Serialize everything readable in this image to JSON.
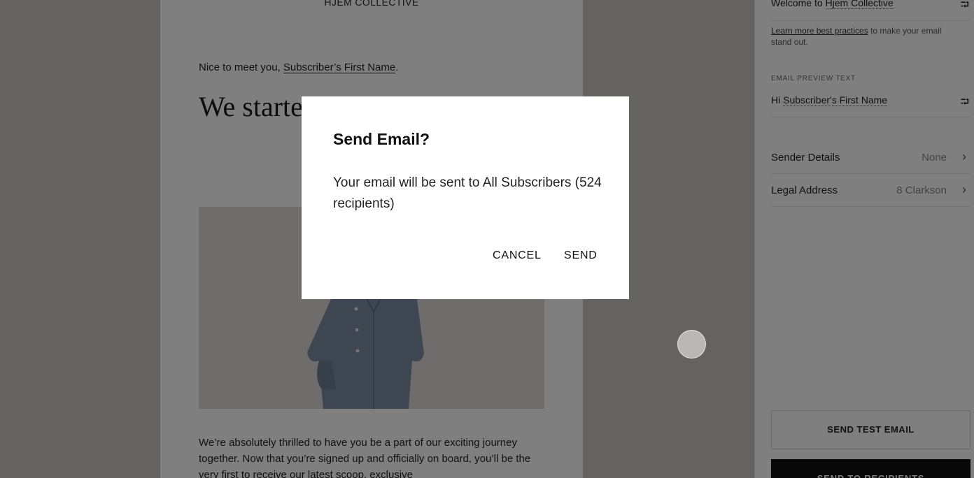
{
  "email": {
    "brand": "HJEM COLLECTIVE",
    "greeting_prefix": "Nice to meet you, ",
    "greeting_merge": "Subscriber’s First Name",
    "greeting_suffix": ".",
    "headline": "We started with a mi products t",
    "body": "We’re absolutely thrilled to have you be a part of our exciting journey together. Now that you’re signed up and officially on board, you’ll be the very first to receive our latest scoop, exclusive"
  },
  "panel": {
    "subject_prefix": "Welcome to ",
    "subject_merge": "Hjem Collective",
    "hint_link": "Learn more best practices",
    "hint_text": " to make your email stand out.",
    "preview_label": "EMAIL PREVIEW TEXT",
    "preview_prefix": "Hi ",
    "preview_merge": "Subscriber's First Name",
    "sender_label": "Sender Details",
    "sender_value": "None",
    "legal_label": "Legal Address",
    "legal_value": "8 Clarkson",
    "send_test_label": "SEND TEST EMAIL",
    "send_recipients_label": "SEND TO RECIPIENTS"
  },
  "dialog": {
    "title": "Send Email?",
    "message": "Your email will be sent to All Subscribers (524 recipients)",
    "cancel_label": "CANCEL",
    "send_label": "SEND"
  },
  "icons": {
    "merge_tag": "insert-merge-tag-icon",
    "chevron": "chevron-right-icon"
  },
  "colors": {
    "overlay": "#000000",
    "primary_button": "#111111"
  }
}
